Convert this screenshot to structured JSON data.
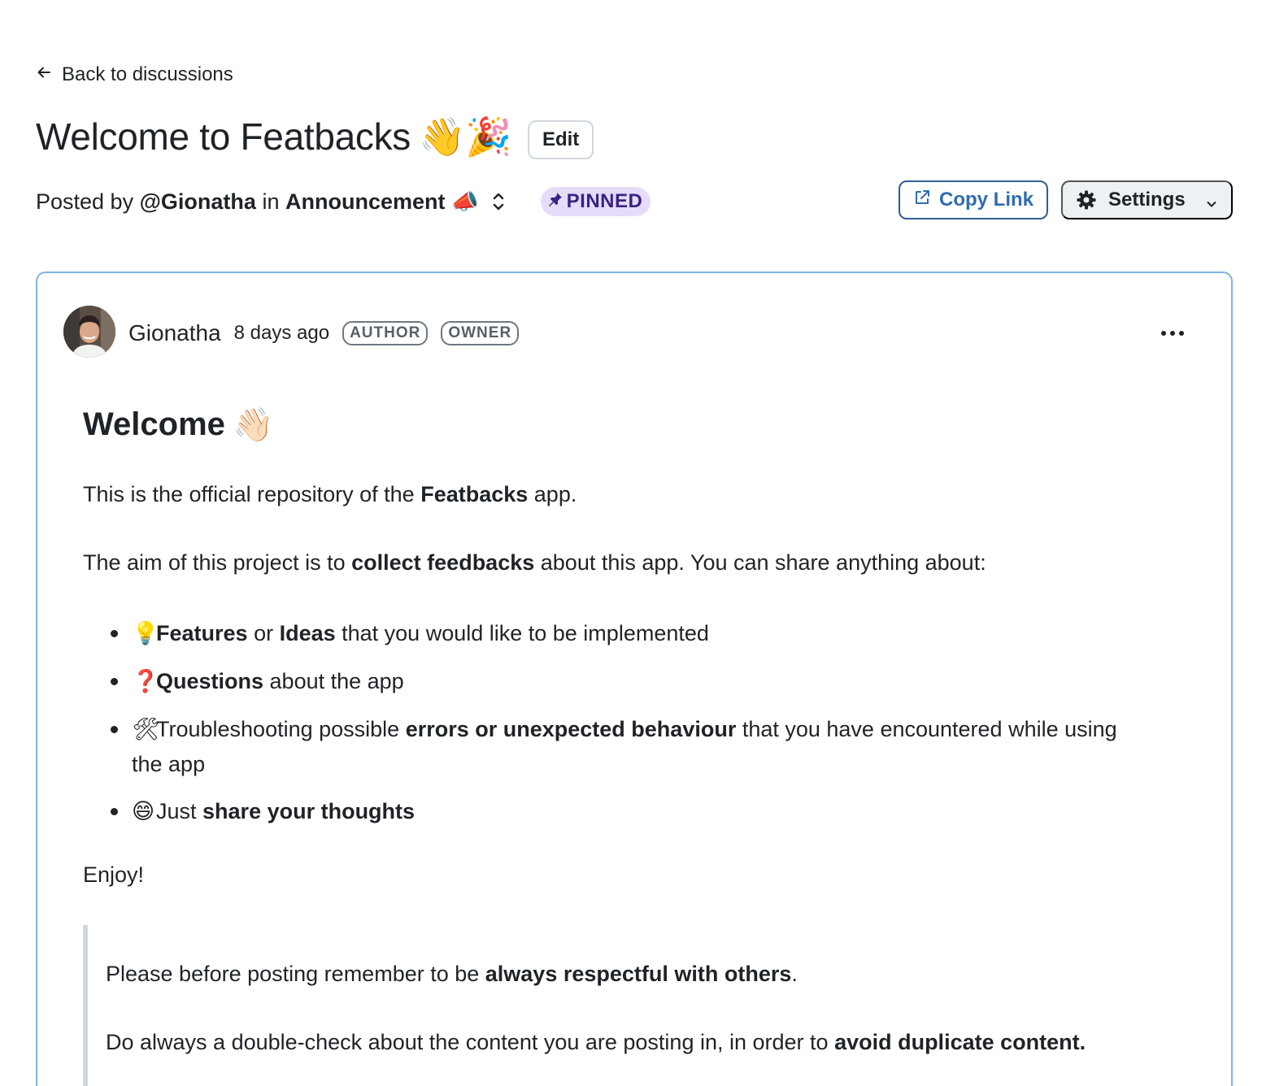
{
  "nav": {
    "back_label": "Back to discussions"
  },
  "discussion": {
    "title": "Welcome to Featbacks",
    "title_emoji": "👋🎉",
    "edit_label": "Edit",
    "posted_by_prefix": "Posted by",
    "author_handle": "@Gionatha",
    "in_label": "in",
    "category": "Announcement",
    "category_emoji": "📣",
    "pinned_label": "PINNED"
  },
  "actions": {
    "copy_link_label": "Copy Link",
    "settings_label": "Settings"
  },
  "post": {
    "author_name": "Gionatha",
    "time": "8 days ago",
    "badges": [
      "AUTHOR",
      "OWNER"
    ],
    "heading": "Welcome",
    "heading_emoji": "👋🏻",
    "p1_a": "This is the official repository of the ",
    "p1_b": "Featbacks",
    "p1_c": " app.",
    "p2_a": "The aim of this project is to ",
    "p2_b": "collect feedbacks",
    "p2_c": " about this app. You can share anything about:",
    "list": [
      {
        "icon": "💡",
        "b1": "Features",
        "t1": " or ",
        "b2": "Ideas",
        "t2": " that you would like to be implemented"
      },
      {
        "icon": "❓",
        "b1": "Questions",
        "t1": " about the app"
      },
      {
        "icon": "🛠",
        "t0": "Troubleshooting possible ",
        "b1": "errors or unexpected behaviour",
        "t1": " that you have encountered while using the app"
      },
      {
        "icon": "😄",
        "t0": "Just ",
        "b1": "share your thoughts"
      }
    ],
    "enjoy": "Enjoy!",
    "quote1_a": "Please before posting remember to be ",
    "quote1_b": "always respectful with others",
    "quote1_c": ".",
    "quote2_a": "Do always a double-check about the content you are posting in, in order to ",
    "quote2_b": "avoid duplicate content."
  },
  "colors": {
    "accent_blue": "#2f6bb0",
    "card_border": "#7fb3e0",
    "pinned_bg": "#e6dcfa",
    "pinned_text": "#3b2383"
  }
}
